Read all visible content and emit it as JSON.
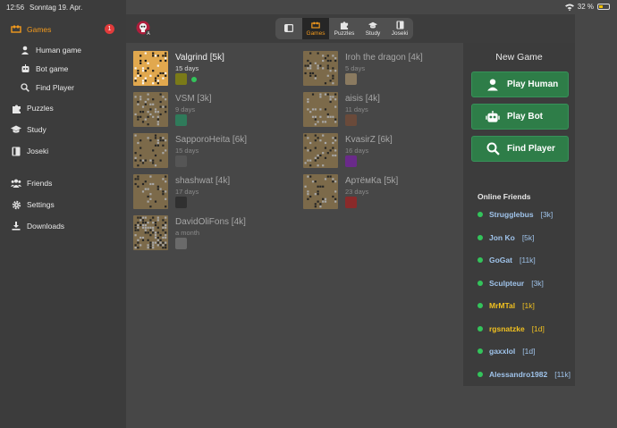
{
  "status": {
    "time": "12:56",
    "date": "Sonntag 19. Apr.",
    "battery": "32 %"
  },
  "sidebar": {
    "items": [
      {
        "label": "Games",
        "icon": "games-icon",
        "badge": "1",
        "active": true
      },
      {
        "label": "Human game",
        "icon": "person-icon"
      },
      {
        "label": "Bot game",
        "icon": "robot-icon"
      },
      {
        "label": "Find Player",
        "icon": "search-icon"
      },
      {
        "label": "Puzzles",
        "icon": "puzzle-icon"
      },
      {
        "label": "Study",
        "icon": "graduation-cap-icon"
      },
      {
        "label": "Joseki",
        "icon": "book-icon"
      },
      {
        "label": "Friends",
        "icon": "friends-icon"
      },
      {
        "label": "Settings",
        "icon": "gear-icon"
      },
      {
        "label": "Downloads",
        "icon": "download-icon"
      }
    ]
  },
  "tabs": [
    {
      "label": "",
      "icon": "sidebar-toggle-icon"
    },
    {
      "label": "Games",
      "icon": "games-icon",
      "selected": true
    },
    {
      "label": "Puzzles",
      "icon": "puzzle-icon"
    },
    {
      "label": "Study",
      "icon": "graduation-cap-icon"
    },
    {
      "label": "Joseki",
      "icon": "book-icon"
    }
  ],
  "games": [
    {
      "name": "Valgrind [5k]",
      "time": "15 days",
      "online": true,
      "highlight": true,
      "avatar": "#7a7a18"
    },
    {
      "name": "Iroh the dragon [4k]",
      "time": "5 days",
      "avatar": "#8a7a60"
    },
    {
      "name": "VSM [3k]",
      "time": "9 days",
      "avatar": "#2f7a5a"
    },
    {
      "name": "aisis [4k]",
      "time": "11 days",
      "avatar": "#6a4a3a"
    },
    {
      "name": "SapporoHeita [6k]",
      "time": "15 days",
      "avatar": "#555555"
    },
    {
      "name": "KvasirZ [6k]",
      "time": "16 days",
      "avatar": "#6a2a8a"
    },
    {
      "name": "shashwat [4k]",
      "time": "17 days",
      "avatar": "#303030"
    },
    {
      "name": "АртёмКа [5k]",
      "time": "23 days",
      "avatar": "#8a2a2a"
    },
    {
      "name": "DavidOliFons [4k]",
      "time": "a month",
      "avatar": "#6a6a6a"
    }
  ],
  "new_game": {
    "title": "New Game",
    "buttons": [
      {
        "label": "Play Human",
        "icon": "person-icon"
      },
      {
        "label": "Play Bot",
        "icon": "robot-icon"
      },
      {
        "label": "Find Player",
        "icon": "search-icon"
      }
    ]
  },
  "online_friends": {
    "title": "Online Friends",
    "list": [
      {
        "name": "Strugglebus",
        "rank": "[3k]",
        "color": "#9fc3ea"
      },
      {
        "name": "Jon Ko",
        "rank": "[5k]",
        "color": "#9fc3ea"
      },
      {
        "name": "GoGat",
        "rank": "[11k]",
        "color": "#9fc3ea"
      },
      {
        "name": "Sculpteur",
        "rank": "[3k]",
        "color": "#9fc3ea"
      },
      {
        "name": "MrMTal",
        "rank": "[1k]",
        "color": "#f0c020"
      },
      {
        "name": "rgsnatzke",
        "rank": "[1d]",
        "color": "#f0c020"
      },
      {
        "name": "gaxxlol",
        "rank": "[1d]",
        "color": "#9fc3ea"
      },
      {
        "name": "Alessandro1982",
        "rank": "[11k]",
        "color": "#9fc3ea"
      }
    ]
  },
  "colors": {
    "accent": "#f39a1d",
    "green": "#2e7d48",
    "online": "#33c45b"
  }
}
